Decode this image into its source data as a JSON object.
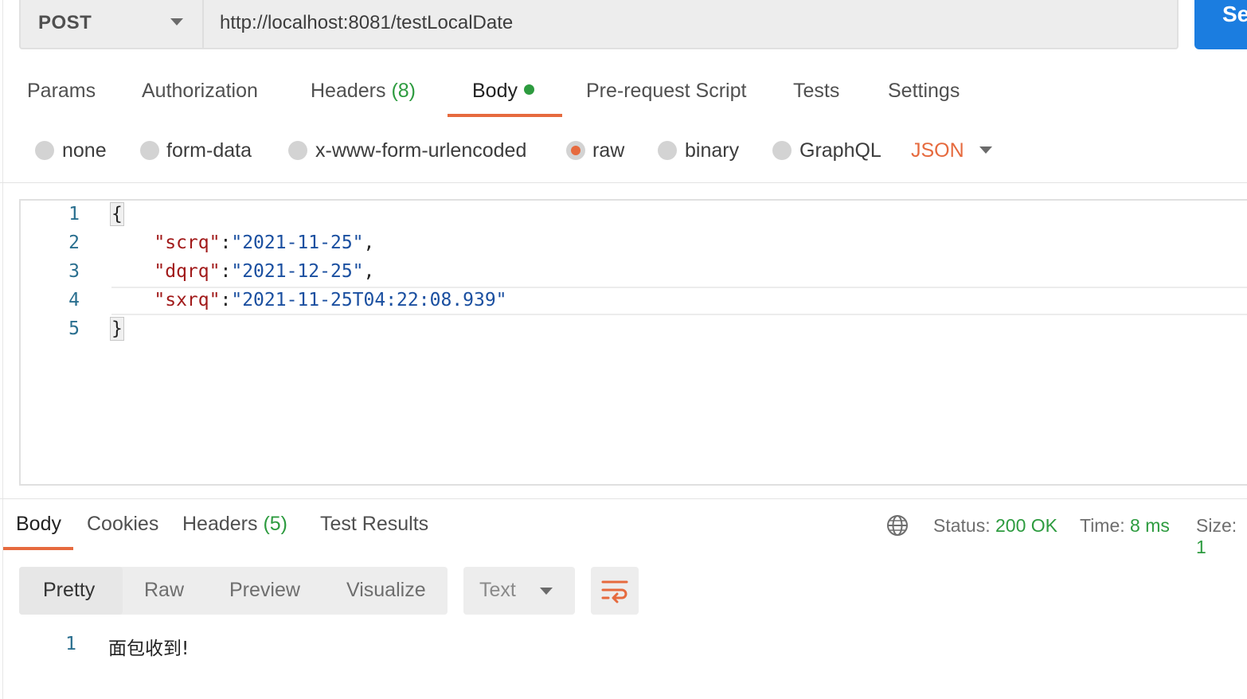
{
  "request": {
    "method": "POST",
    "url": "http://localhost:8081/testLocalDate",
    "send_label": "Se"
  },
  "request_tabs": [
    {
      "label": "Params"
    },
    {
      "label": "Authorization"
    },
    {
      "label": "Headers",
      "count": "(8)"
    },
    {
      "label": "Body",
      "active": true
    },
    {
      "label": "Pre-request Script"
    },
    {
      "label": "Tests"
    },
    {
      "label": "Settings"
    }
  ],
  "body_types": {
    "options": [
      "none",
      "form-data",
      "x-www-form-urlencoded",
      "raw",
      "binary",
      "GraphQL"
    ],
    "selected": "raw",
    "format": "JSON"
  },
  "editor": {
    "line_numbers": [
      "1",
      "2",
      "3",
      "4",
      "5"
    ],
    "open_brace": "{",
    "close_brace": "}",
    "fields": [
      {
        "key": "\"scrq\"",
        "value": "\"2021-11-25\"",
        "trailing": ","
      },
      {
        "key": "\"dqrq\"",
        "value": "\"2021-12-25\"",
        "trailing": ","
      },
      {
        "key": "\"sxrq\"",
        "value": "\"2021-11-25T04:22:08.939\"",
        "trailing": ""
      }
    ]
  },
  "response_tabs": [
    {
      "label": "Body",
      "active": true
    },
    {
      "label": "Cookies"
    },
    {
      "label": "Headers",
      "count": "(5)"
    },
    {
      "label": "Test Results"
    }
  ],
  "response_status": {
    "status_label": "Status:",
    "status_value": "200 OK",
    "time_label": "Time:",
    "time_value": "8 ms",
    "size_label": "Size:",
    "size_value": "1"
  },
  "view_modes": [
    "Pretty",
    "Raw",
    "Preview",
    "Visualize"
  ],
  "active_view": "Pretty",
  "response_format": "Text",
  "response_body": {
    "line_number": "1",
    "text": "面包收到!"
  },
  "colors": {
    "accent": "#e66a3e",
    "primary_button": "#1b7de0",
    "success": "#2d9b3f"
  },
  "icons": [
    "chevron-down-icon",
    "globe-icon",
    "wrap-lines-icon"
  ]
}
